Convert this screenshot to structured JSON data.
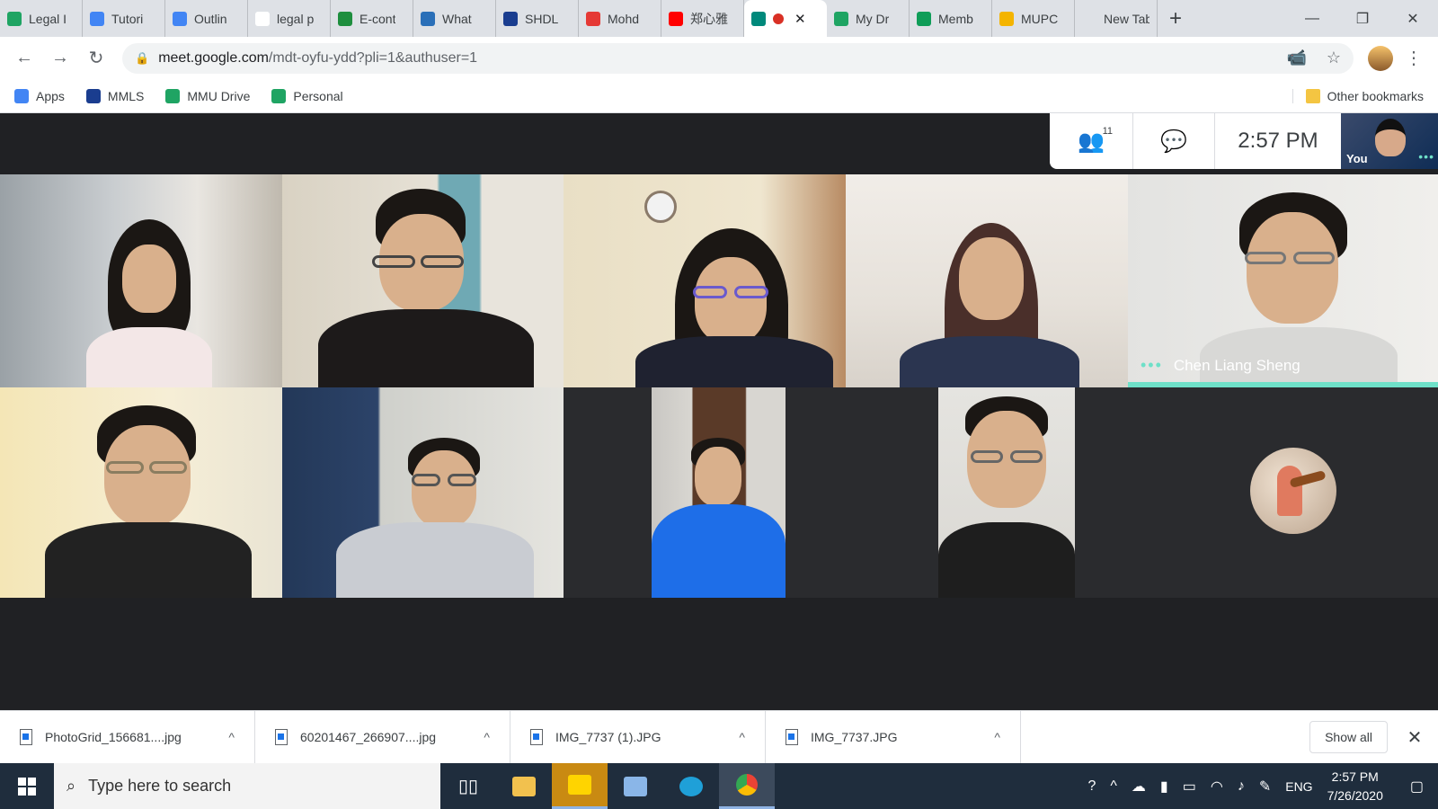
{
  "browser": {
    "tabs": [
      {
        "label": "Legal I",
        "color": "#1fa463"
      },
      {
        "label": "Tutori",
        "color": "#4285f4"
      },
      {
        "label": "Outlin",
        "color": "#4285f4"
      },
      {
        "label": "legal p",
        "color": "#ffffff"
      },
      {
        "label": "E-cont",
        "color": "#1e8e3e"
      },
      {
        "label": "What",
        "color": "#2a6fb8"
      },
      {
        "label": "SHDL",
        "color": "#1a3d8f"
      },
      {
        "label": "Mohd",
        "color": "#e53935"
      },
      {
        "label": "郑心雅",
        "color": "#ff0000"
      },
      {
        "label": "",
        "color": "#00897b",
        "active": true,
        "recording": true
      },
      {
        "label": "My Dr",
        "color": "#1fa463"
      },
      {
        "label": "Memb",
        "color": "#0f9d58"
      },
      {
        "label": "MUPC",
        "color": "#f4b400"
      },
      {
        "label": "New Tab",
        "color": "transparent"
      }
    ],
    "new_tab": "+",
    "win_controls": {
      "minimize": "—",
      "restore": "❐",
      "close": "✕"
    },
    "toolbar": {
      "back": "←",
      "forward": "→",
      "reload": "↻",
      "lock": "🔒",
      "url_host": "meet.google.com",
      "url_path": "/mdt-oyfu-ydd?pli=1&authuser=1",
      "camera": "📹",
      "star": "☆",
      "menu": "⋮"
    },
    "bookmarks": [
      {
        "label": "Apps",
        "color": "#4285f4"
      },
      {
        "label": "MMLS",
        "color": "#1a3d8f"
      },
      {
        "label": "MMU Drive",
        "color": "#1fa463"
      },
      {
        "label": "Personal",
        "color": "#1fa463"
      }
    ],
    "other_bookmarks": "Other bookmarks"
  },
  "meet": {
    "participants_count": "11",
    "people_icon": "👥",
    "chat_icon": "💬",
    "time": "2:57 PM",
    "self_label": "You",
    "active_speaker": "Chen Liang Sheng",
    "accent": "#6ee0c8"
  },
  "downloads": {
    "items": [
      {
        "name": "PhotoGrid_156681....jpg"
      },
      {
        "name": "60201467_266907....jpg"
      },
      {
        "name": "IMG_7737 (1).JPG"
      },
      {
        "name": "IMG_7737.JPG"
      }
    ],
    "chevron": "^",
    "show_all": "Show all",
    "close": "✕"
  },
  "taskbar": {
    "search_placeholder": "Type here to search",
    "language": "ENG",
    "clock_time": "2:57 PM",
    "clock_date": "7/26/2020"
  }
}
